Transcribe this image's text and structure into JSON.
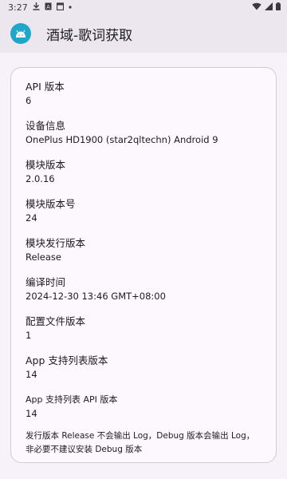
{
  "status_bar": {
    "time": "3:27",
    "icons": [
      "download-icon",
      "a-badge-icon",
      "calendar-icon",
      "dot-icon",
      "wifi-icon",
      "signal-icon",
      "battery-icon"
    ]
  },
  "app_bar": {
    "title": "酒域-歌词获取",
    "icon": "android-icon",
    "icon_color": "#1fa6c9"
  },
  "info": {
    "api_version_label": "API 版本",
    "api_version_value": "6",
    "device_label": "设备信息",
    "device_value": "OnePlus HD1900 (star2qltechn) Android 9",
    "module_version_label": "模块版本",
    "module_version_value": "2.0.16",
    "module_version_code_label": "模块版本号",
    "module_version_code_value": "24",
    "release_label": "模块发行版本",
    "release_value": "Release",
    "compile_time_label": "编译时间",
    "compile_time_value": "2024-12-30 13:46 GMT+08:00",
    "config_version_label": "配置文件版本",
    "config_version_value": "1",
    "app_list_version_label": "App 支持列表版本",
    "app_list_version_value": "14",
    "app_list_api_label": "App 支持列表 API 版本",
    "app_list_api_value": "14"
  },
  "footnote": "发行版本 Release 不会输出 Log，Debug 版本会输出 Log，非必要不建议安装 Debug 版本"
}
